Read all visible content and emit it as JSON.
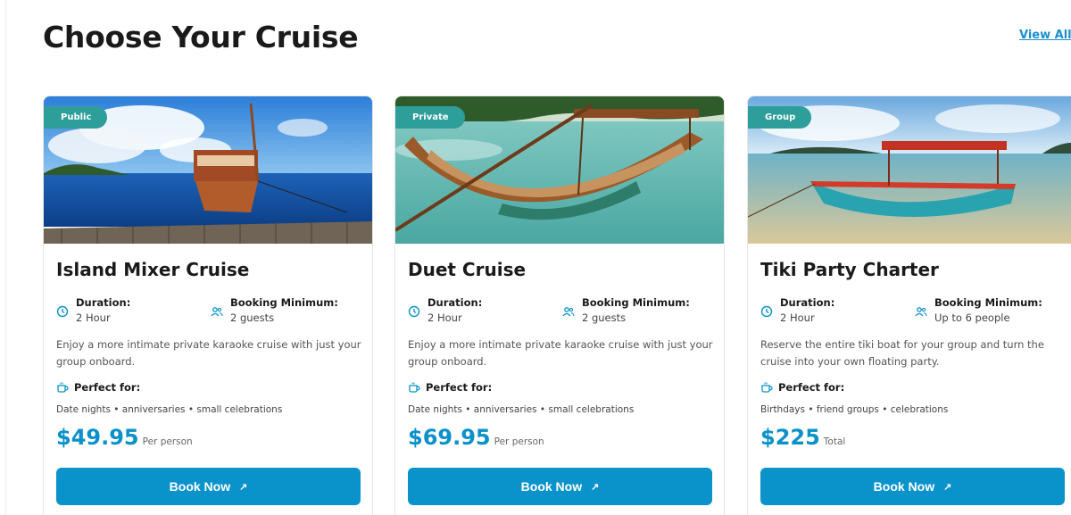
{
  "page": {
    "title": "Choose Your Cruise",
    "view_all": "View All ›"
  },
  "labels": {
    "duration": "Duration:",
    "booking_minimum": "Booking Minimum:",
    "perfect_for": "Perfect for:",
    "book_now": "Book Now",
    "book_arrow": "↗"
  },
  "colors": {
    "accent": "#0a93ca",
    "badge": "#2e9e9a",
    "link": "#1a8fd1"
  },
  "icons": {
    "duration": "clock-icon",
    "booking": "users-icon",
    "perfect": "cup-icon",
    "book": "arrow-up-right-icon"
  },
  "cards": [
    {
      "badge": "Public",
      "title": "Island Mixer Cruise",
      "duration": "2 Hour",
      "booking_minimum": "2 guests",
      "description": "Enjoy a more intimate private karaoke cruise with just your group onboard.",
      "perfect_for": "Date nights • anniversaries • small celebrations",
      "price": "$49.95",
      "price_unit": "Per person"
    },
    {
      "badge": "Private",
      "title": "Duet Cruise",
      "duration": "2 Hour",
      "booking_minimum": "2 guests",
      "description": "Enjoy a more intimate private karaoke cruise with just your group onboard.",
      "perfect_for": "Date nights • anniversaries • small celebrations",
      "price": "$69.95",
      "price_unit": "Per person"
    },
    {
      "badge": "Group",
      "title": "Tiki Party Charter",
      "duration": "2 Hour",
      "booking_minimum": "Up to 6 people",
      "description": "Reserve the entire tiki boat for your group and turn the cruise into your own floating party.",
      "perfect_for": "Birthdays • friend groups • celebrations",
      "price": "$225",
      "price_unit": "Total"
    }
  ]
}
